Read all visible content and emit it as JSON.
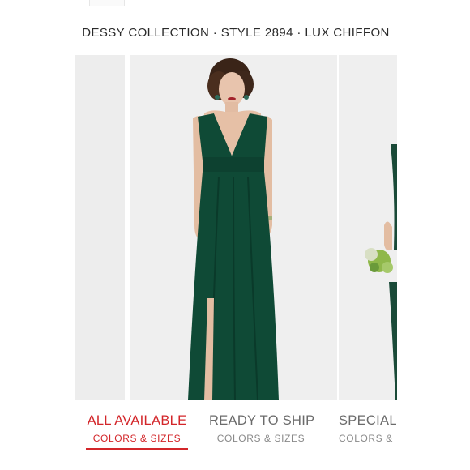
{
  "header": {
    "title": "DESSY COLLECTION · STYLE 2894 · LUX CHIFFON"
  },
  "carousel": {
    "slides": [
      {
        "name": "previous-product-image"
      },
      {
        "name": "main-product-image"
      },
      {
        "name": "next-product-image"
      }
    ],
    "dress_color": "#0f4a36",
    "background_color": "#efefef"
  },
  "tabs": [
    {
      "title": "ALL AVAILABLE",
      "subtitle": "COLORS & SIZES",
      "active": true
    },
    {
      "title": "READY TO SHIP",
      "subtitle": "COLORS & SIZES",
      "active": false
    },
    {
      "title": "SPECIAL",
      "subtitle": "COLORS &",
      "active": false
    }
  ],
  "colors": {
    "accent": "#d3262a",
    "inactive_text": "#6b6b6b"
  }
}
